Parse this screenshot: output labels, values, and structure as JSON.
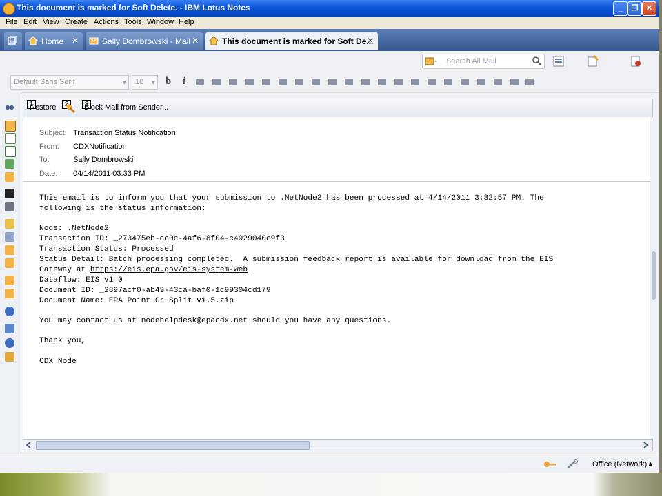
{
  "window": {
    "title": "This document is marked for Soft Delete. - IBM Lotus Notes",
    "min_label": "_",
    "max_label": "❐",
    "close_label": "✕"
  },
  "menu": [
    "File",
    "Edit",
    "View",
    "Create",
    "Actions",
    "Tools",
    "Window",
    "Help"
  ],
  "tabs": [
    {
      "label": "Home",
      "close": "✕"
    },
    {
      "label": "Sally Dombrowski - Mail",
      "close": "✕"
    },
    {
      "label": "This document is marked for Soft De...",
      "close": "✕"
    }
  ],
  "toolbar": {
    "search_placeholder": "Search All Mail",
    "font_family": "Default Sans Serif",
    "font_size": "10",
    "bold_label": "b",
    "italic_label": "i"
  },
  "actions": {
    "restore_label": "Restore",
    "block_label": "Block Mail from Sender...",
    "markers": [
      "1",
      "2",
      "3"
    ]
  },
  "header": {
    "subject_label": "Subject:",
    "subject": "Transaction Status Notification",
    "from_label": "From:",
    "from": "CDXNotification",
    "to_label": "To:",
    "to": "Sally Dombrowski",
    "date_label": "Date:",
    "date": "04/14/2011 03:33 PM"
  },
  "body": {
    "line1": "This email is to inform you that your submission to .NetNode2 has been processed at 4/14/2011 3:32:57 PM. The",
    "line2": "following is the status information:",
    "line3": "Node: .NetNode2",
    "line4": "Transaction ID: _273475eb-cc0c-4af6-8f04-c4929040c9f3",
    "line5": "Transaction Status: Processed",
    "line6": "Status Detail: Batch processing completed.  A submission feedback report is available for download from the EIS",
    "line7_prefix": "Gateway at ",
    "line7_link": "https://eis.epa.gov/eis-system-web",
    "line7_suffix": ".",
    "line8": "Dataflow: EIS_v1_0",
    "line9": "Document ID: _2897acf0-ab49-43ca-baf0-1c99304cd179",
    "line10": "Document Name: EPA Point Cr Split v1.5.zip",
    "line11": "You may contact us at nodehelpdesk@epacdx.net should you have any questions.",
    "line12": "Thank you,",
    "line13": "CDX Node"
  },
  "status": {
    "location": "Office (Network)",
    "arrow": "▲"
  },
  "icons": [
    "lotus-notes-icon",
    "home-icon",
    "mail-icon",
    "document-icon",
    "search-icon",
    "bold-icon",
    "italic-icon",
    "restore-icon",
    "block-sender-icon",
    "key-icon",
    "scroll-left-icon",
    "scroll-right-icon"
  ],
  "colors": {
    "titlebar": "#0a55d8",
    "tabbar": "#35588f",
    "active_tab": "#eef1f6",
    "link": "#000000"
  }
}
